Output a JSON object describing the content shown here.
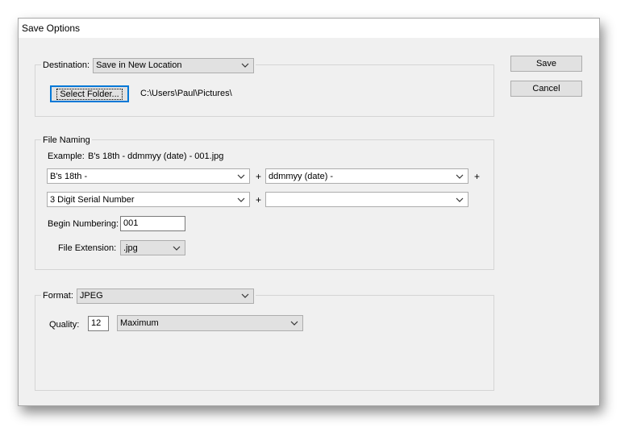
{
  "window": {
    "title": "Save Options"
  },
  "buttons": {
    "save": "Save",
    "cancel": "Cancel"
  },
  "destination": {
    "label": "Destination:",
    "selected": "Save in New Location",
    "select_folder": "Select Folder...",
    "path": "C:\\Users\\Paul\\Pictures\\"
  },
  "file_naming": {
    "legend": "File Naming",
    "example_label": "Example:",
    "example_value": "B's 18th - ddmmyy (date) - 001.jpg",
    "field1": "B's 18th -",
    "field2": "ddmmyy (date) -",
    "field3": "3 Digit Serial Number",
    "field4": "",
    "plus": "+",
    "begin_label": "Begin Numbering:",
    "begin_value": "001",
    "ext_label": "File Extension:",
    "ext_value": ".jpg"
  },
  "format": {
    "label": "Format:",
    "selected": "JPEG",
    "quality_label": "Quality:",
    "quality_value": "12",
    "quality_preset": "Maximum"
  }
}
